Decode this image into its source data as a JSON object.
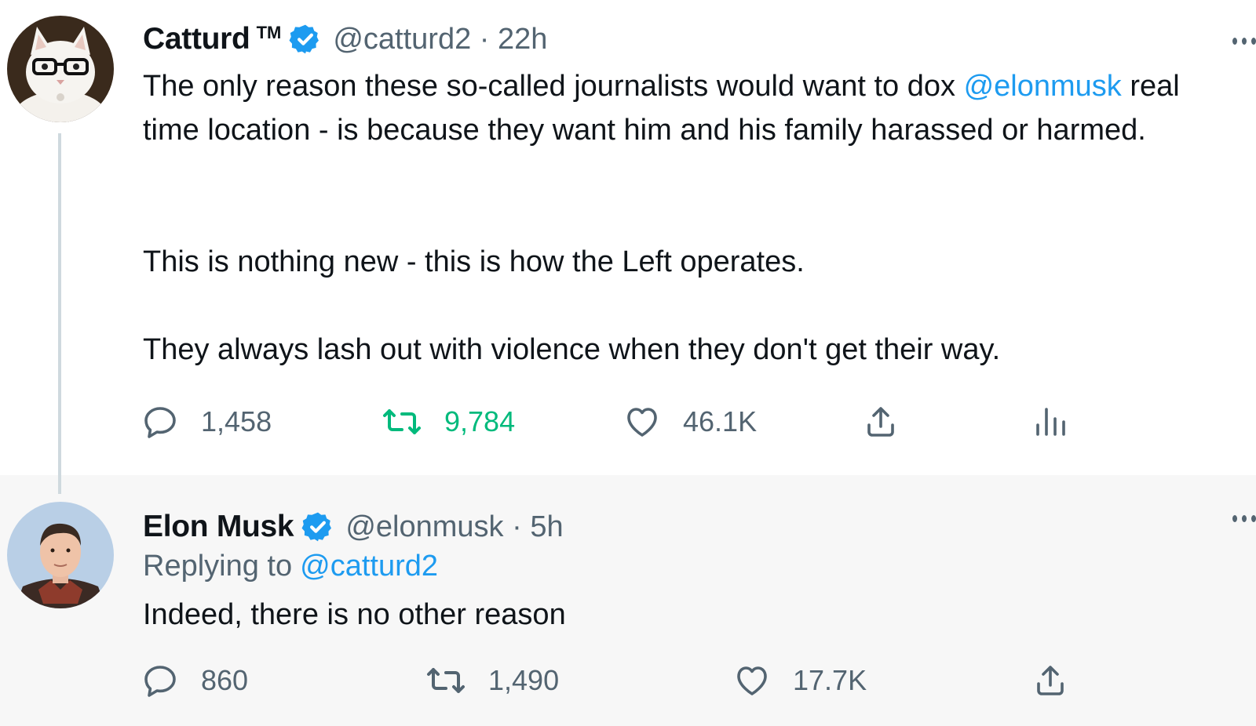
{
  "tweets": [
    {
      "author": {
        "name": "Catturd",
        "trademark": "TM",
        "handle": "@catturd2",
        "time": "22h",
        "verified": true
      },
      "body": {
        "p1_before_mention": "The only reason these so-called journalists would want to dox ",
        "p1_mention": "@elonmusk",
        "p1_after_mention": " real time location - is because they want him and his family harassed or harmed.",
        "p2": "This is nothing new - this is how the Left operates.",
        "p3": "They always lash out with violence when they don't get their way."
      },
      "metrics": {
        "replies": "1,458",
        "retweets": "9,784",
        "likes": "46.1K"
      },
      "retweeted": true
    },
    {
      "author": {
        "name": "Elon Musk",
        "handle": "@elonmusk",
        "time": "5h",
        "verified": true
      },
      "replying_to_label": "Replying to",
      "replying_to_handle": "@catturd2",
      "body": "Indeed, there is no other reason",
      "metrics": {
        "replies": "860",
        "retweets": "1,490",
        "likes": "17.7K"
      }
    }
  ],
  "icons": {
    "reply": "reply-icon",
    "retweet": "retweet-icon",
    "like": "heart-icon",
    "share": "share-icon",
    "analytics": "analytics-icon",
    "verified": "verified-badge-icon",
    "more": "more-icon"
  },
  "colors": {
    "link": "#1d9bf0",
    "retweet_active": "#00ba7c",
    "secondary_text": "#536471",
    "verified_badge": "#1d9bf0"
  }
}
